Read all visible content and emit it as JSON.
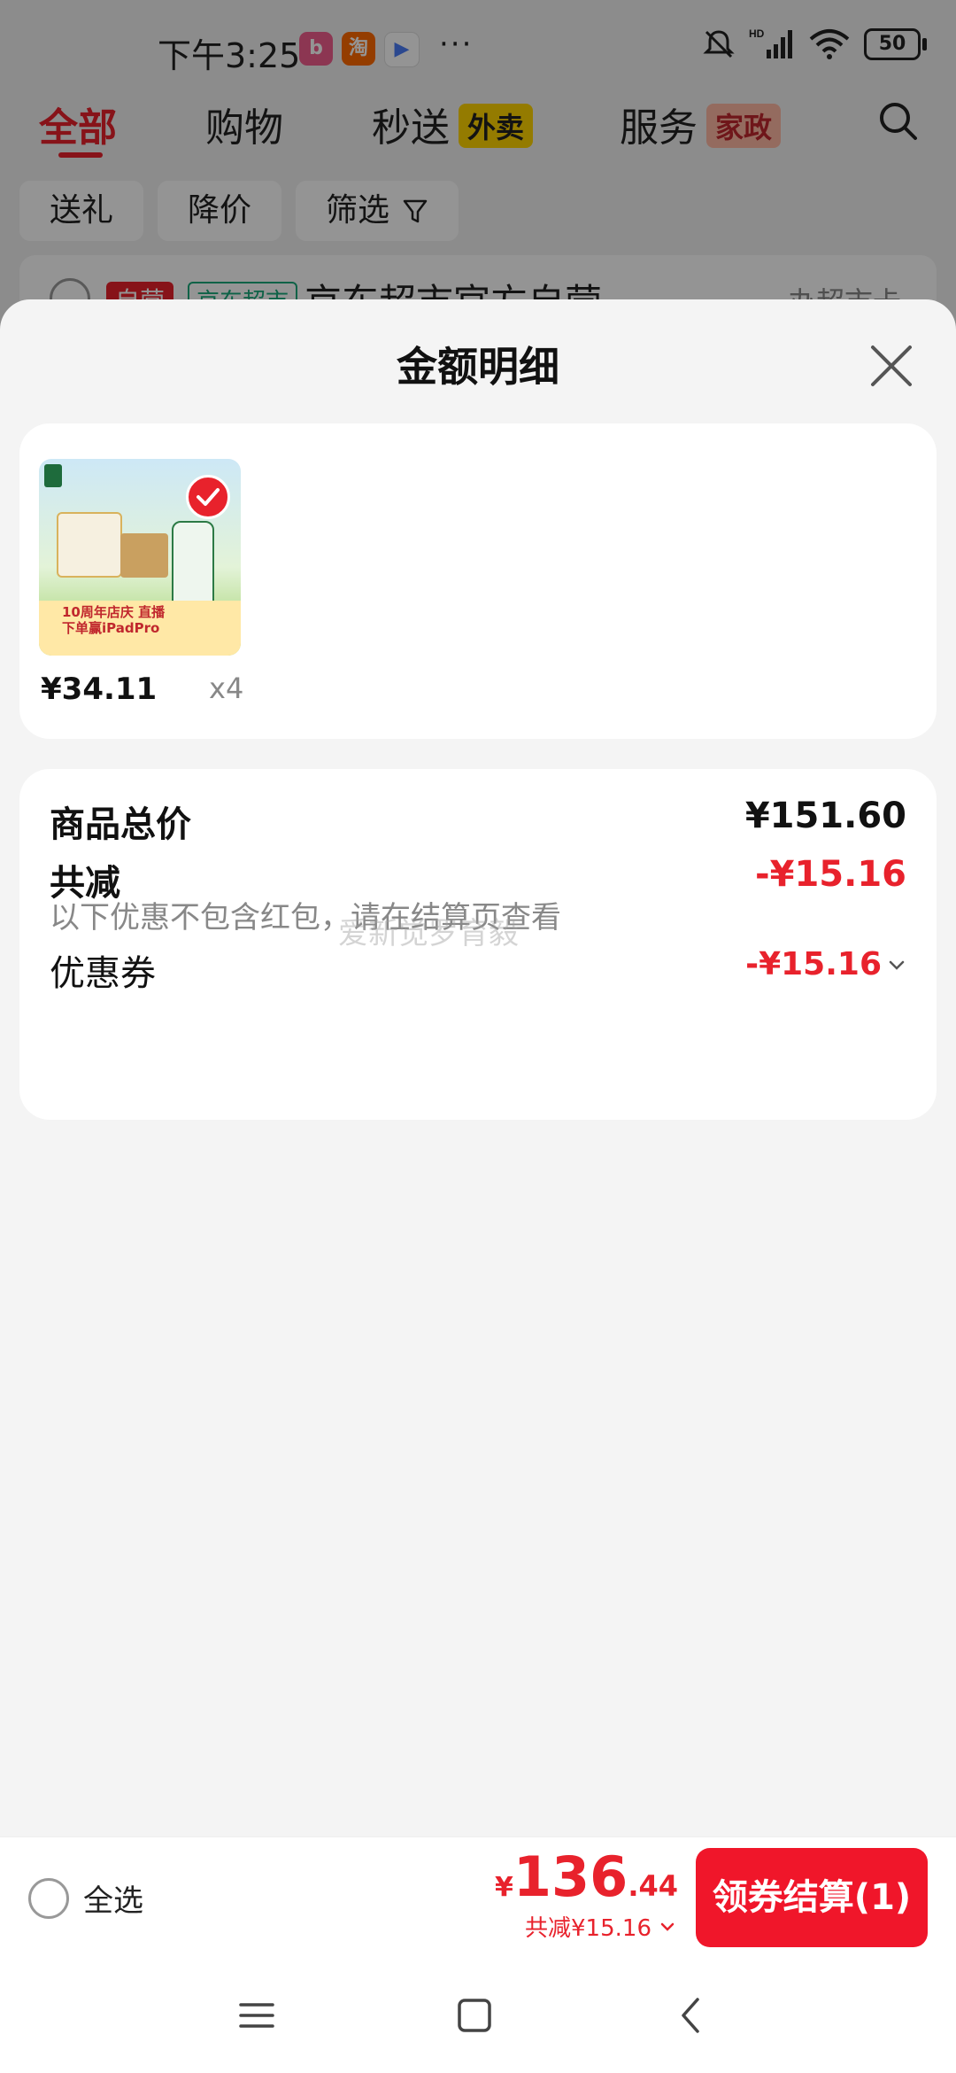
{
  "status_bar": {
    "time": "下午3:25",
    "apps": [
      {
        "icon": "bilibili-icon",
        "label": "bili",
        "color": "#f25d8e"
      },
      {
        "icon": "taobao-icon",
        "label": "淘",
        "color": "#ff6a00"
      },
      {
        "icon": "video-icon",
        "label": "",
        "color": "#4a7cf7"
      }
    ],
    "more": "···",
    "network": "HD",
    "battery": "50"
  },
  "background": {
    "tabs": [
      "全部",
      "购物",
      "秒送",
      "服务"
    ],
    "tab_tags": {
      "秒送": "外卖",
      "服务": "家政"
    },
    "filters": [
      "送礼",
      "降价",
      "筛选"
    ],
    "shop": {
      "tag_self": "自营",
      "tag_market": "京东超市",
      "name": "京东超市官方自营",
      "card": "办超市卡"
    }
  },
  "sheet": {
    "title": "金额明细",
    "product": {
      "price": "¥34.11",
      "quantity": "x4",
      "image_text": "10周年店庆 直播下单赢iPadPro"
    },
    "summary": {
      "total_label": "商品总价",
      "total_value": "¥151.60",
      "discount_label": "共减",
      "discount_value": "-¥15.16",
      "note": "以下优惠不包含红包，请在结算页查看",
      "watermark": "爱新觉罗育毅",
      "coupon_label": "优惠券",
      "coupon_value": "-¥15.16"
    }
  },
  "checkout": {
    "select_all": "全选",
    "currency": "¥",
    "total_int": "136",
    "total_dec": ".44",
    "saved": "共减¥15.16",
    "button": "领券结算(1)"
  },
  "colors": {
    "accent": "#e8222c",
    "button": "#f0162a"
  }
}
